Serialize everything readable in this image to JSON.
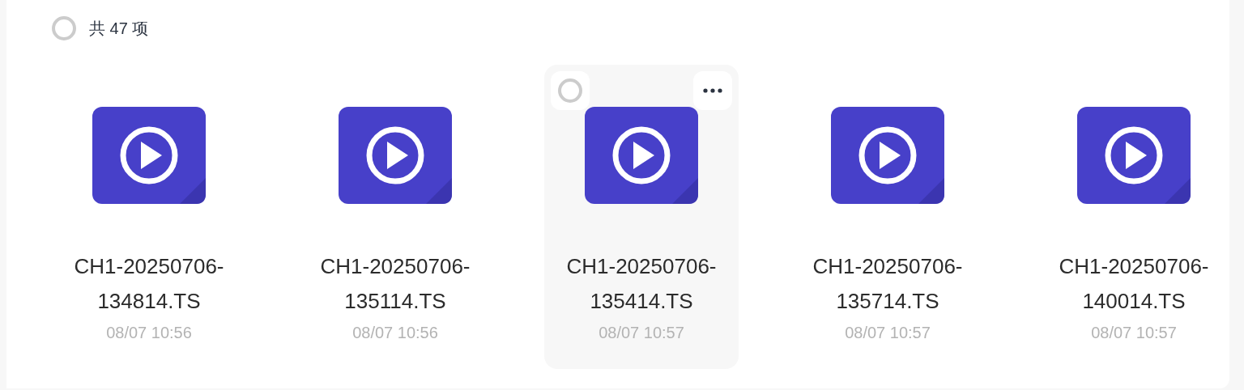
{
  "header": {
    "select_all": {
      "checked": false
    },
    "count": "共 47 项"
  },
  "files": [
    {
      "name": "CH1-20250706-134814.TS",
      "date": "08/07 10:56",
      "hovered": false,
      "checked": false
    },
    {
      "name": "CH1-20250706-135114.TS",
      "date": "08/07 10:56",
      "hovered": false,
      "checked": false
    },
    {
      "name": "CH1-20250706-135414.TS",
      "date": "08/07 10:57",
      "hovered": true,
      "checked": false
    },
    {
      "name": "CH1-20250706-135714.TS",
      "date": "08/07 10:57",
      "hovered": false,
      "checked": false
    },
    {
      "name": "CH1-20250706-140014.TS",
      "date": "08/07 10:57",
      "hovered": false,
      "checked": false
    }
  ]
}
